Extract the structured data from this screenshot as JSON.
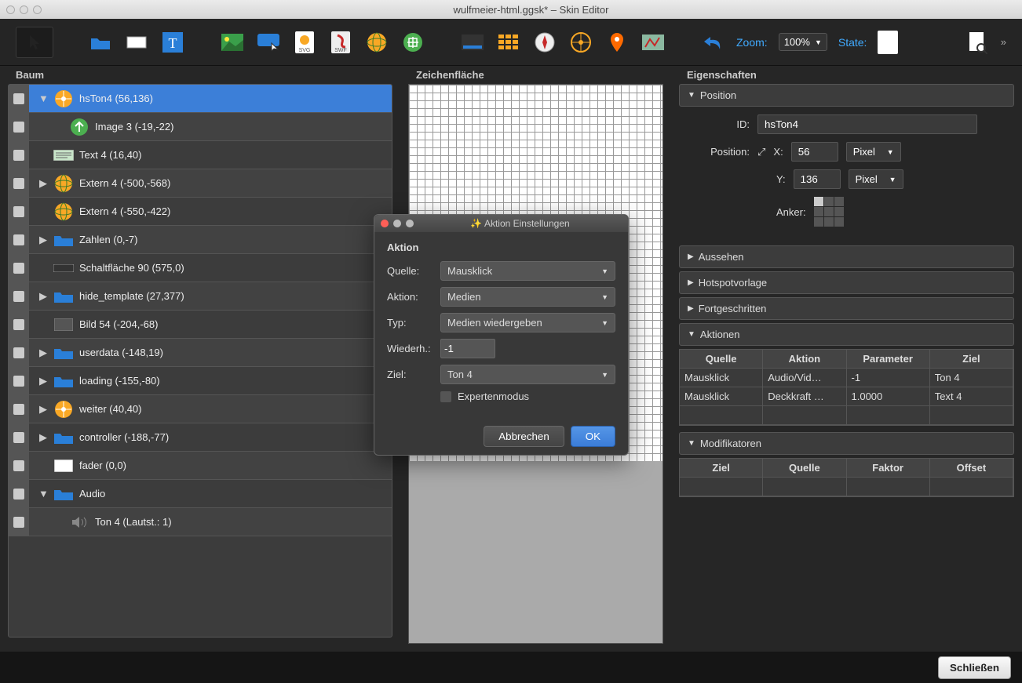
{
  "window": {
    "title": "wulfmeier-html.ggsk* – Skin Editor"
  },
  "toolbar": {
    "zoom_label": "Zoom:",
    "zoom_value": "100%",
    "state_label": "State:"
  },
  "panels": {
    "tree": "Baum",
    "canvas": "Zeichenfläche",
    "props": "Eigenschaften"
  },
  "tree": {
    "items": [
      {
        "label": "hsTon4 (56,136)",
        "selected": true,
        "icon": "hotspot",
        "toggle": "▼"
      },
      {
        "label": "Image 3 (-19,-22)",
        "indent": 1,
        "icon": "image-green"
      },
      {
        "label": "Text 4 (16,40)",
        "icon": "text"
      },
      {
        "label": "Extern 4 (-500,-568)",
        "icon": "globe",
        "toggle": "▶"
      },
      {
        "label": "Extern 4 (-550,-422)",
        "icon": "globe"
      },
      {
        "label": "Zahlen (0,-7)",
        "icon": "folder",
        "toggle": "▶"
      },
      {
        "label": "Schaltfläche 90 (575,0)",
        "icon": "button"
      },
      {
        "label": "hide_template (27,377)",
        "icon": "folder",
        "toggle": "▶"
      },
      {
        "label": "Bild 54 (-204,-68)",
        "icon": "image"
      },
      {
        "label": "userdata (-148,19)",
        "icon": "folder",
        "toggle": "▶"
      },
      {
        "label": "loading (-155,-80)",
        "icon": "folder",
        "toggle": "▶"
      },
      {
        "label": "weiter (40,40)",
        "icon": "hotspot",
        "toggle": "▶"
      },
      {
        "label": "controller (-188,-77)",
        "icon": "folder",
        "toggle": "▶"
      },
      {
        "label": "fader (0,0)",
        "icon": "rect"
      },
      {
        "label": "Audio",
        "icon": "folder",
        "toggle": "▼"
      },
      {
        "label": "Ton 4 (Lautst.: 1)",
        "indent": 1,
        "icon": "sound"
      }
    ]
  },
  "props": {
    "sections": {
      "position": "Position",
      "appearance": "Aussehen",
      "hotspot": "Hotspotvorlage",
      "advanced": "Fortgeschritten",
      "actions": "Aktionen",
      "modifiers": "Modifikatoren"
    },
    "position": {
      "id_label": "ID:",
      "id_value": "hsTon4",
      "pos_label": "Position:",
      "x_label": "X:",
      "x_value": "56",
      "x_unit": "Pixel",
      "y_label": "Y:",
      "y_value": "136",
      "y_unit": "Pixel",
      "anchor_label": "Anker:"
    },
    "actions_table": {
      "headers": [
        "Quelle",
        "Aktion",
        "Parameter",
        "Ziel"
      ],
      "rows": [
        [
          "Mausklick",
          "Audio/Vid…",
          "-1",
          "Ton 4"
        ],
        [
          "Mausklick",
          "Deckkraft …",
          "1.0000",
          "Text 4"
        ]
      ]
    },
    "modifiers_table": {
      "headers": [
        "Ziel",
        "Quelle",
        "Faktor",
        "Offset"
      ]
    }
  },
  "dialog": {
    "title": "Aktion Einstellungen",
    "section": "Aktion",
    "rows": {
      "quelle": {
        "label": "Quelle:",
        "value": "Mausklick"
      },
      "aktion": {
        "label": "Aktion:",
        "value": "Medien"
      },
      "typ": {
        "label": "Typ:",
        "value": "Medien wiedergeben"
      },
      "wiederh": {
        "label": "Wiederh.:",
        "value": "-1"
      },
      "ziel": {
        "label": "Ziel:",
        "value": "Ton 4"
      },
      "expert": "Expertenmodus"
    },
    "cancel": "Abbrechen",
    "ok": "OK"
  },
  "footer": {
    "close": "Schließen"
  }
}
